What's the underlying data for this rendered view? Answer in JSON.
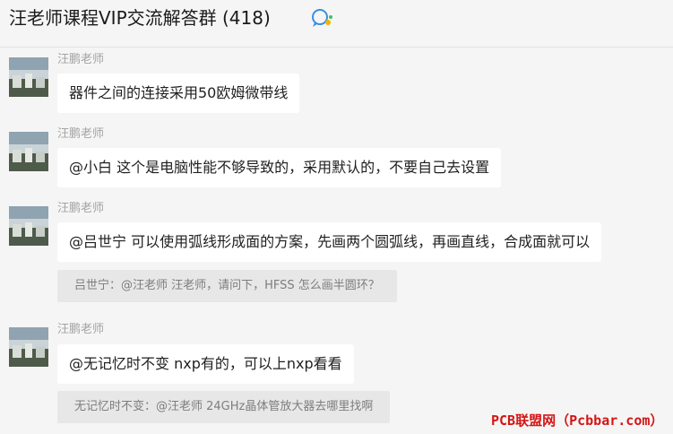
{
  "header": {
    "title": "汪老师课程VIP交流解答群 (418)",
    "group_icon": "group-chat-icon"
  },
  "messages": [
    {
      "sender": "汪鹏老师",
      "text": "器件之间的连接采用50欧姆微带线",
      "quote": ""
    },
    {
      "sender": "汪鹏老师",
      "text": "@小白 这个是电脑性能不够导致的，采用默认的，不要自己去设置",
      "quote": ""
    },
    {
      "sender": "汪鹏老师",
      "text": "@吕世宁 可以使用弧线形成面的方案，先画两个圆弧线，再画直线，合成面就可以",
      "quote": "吕世宁：@汪老师  汪老师，请问下，HFSS 怎么画半圆环？"
    },
    {
      "sender": "汪鹏老师",
      "text": "@无记忆时不变 nxp有的，可以上nxp看看",
      "quote": "无记忆时不变：@汪老师 24GHz晶体管放大器去哪里找啊"
    }
  ],
  "watermark": "PCB联盟网（Pcbbar.com）",
  "colors": {
    "background": "#f5f5f5",
    "bubble": "#ffffff",
    "quote": "#e7e7e7",
    "watermark": "#d41616"
  }
}
